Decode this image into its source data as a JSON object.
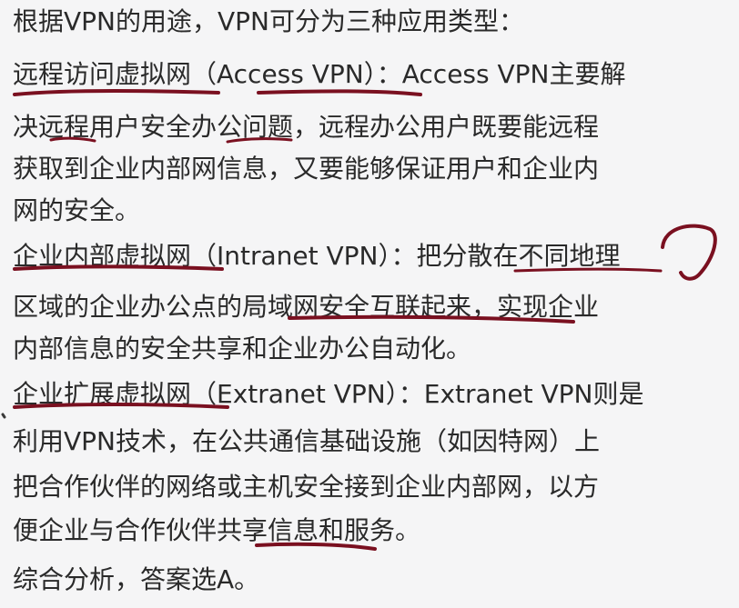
{
  "document": {
    "lines": [
      "根据VPN的用途，VPN可分为三种应用类型：",
      "远程访问虚拟网（Access VPN）：Access VPN主要解",
      "决远程用户安全办公问题，远程办公用户既要能远程",
      "获取到企业内部网信息，又要能够保证用户和企业内",
      "网的安全。",
      "企业内部虚拟网（Intranet VPN）：把分散在不同地理",
      "区域的企业办公点的局域网安全互联起来，实现企业",
      "内部信息的安全共享和企业办公自动化。",
      "企业扩展虚拟网（Extranet VPN）：Extranet VPN则是",
      "利用VPN技术，在公共通信基础设施（如因特网）上",
      "把合作伙伴的网络或主机安全接到企业内部网，以方",
      "便企业与合作伙伴共享信息和服务。",
      "综合分析，答案选A。"
    ]
  },
  "annotation_color": "#7a1020"
}
